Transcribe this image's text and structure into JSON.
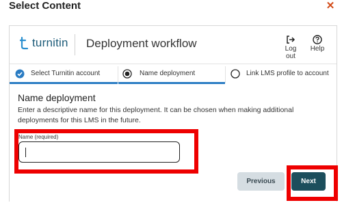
{
  "modal": {
    "title": "Select Content",
    "close_icon": "close-icon",
    "close_color": "#d24a17"
  },
  "app": {
    "logo_text": "turnitin",
    "logo_color": "#1b5a78",
    "title": "Deployment workflow",
    "logout_label": "Log out",
    "help_label": "Help"
  },
  "stepper": {
    "accent_color": "#2a7cc3",
    "steps": [
      {
        "label": "Select Turnitin account",
        "state": "completed",
        "icon": "check-circle-icon"
      },
      {
        "label": "Name deployment",
        "state": "current",
        "icon": "radio-selected-icon"
      },
      {
        "label": "Link LMS profile to account",
        "state": "pending",
        "icon": "radio-empty-icon"
      }
    ]
  },
  "form": {
    "section_title": "Name deployment",
    "description": "Enter a descriptive name for this deployment. It can be chosen when making additional deployments for this LMS in the future.",
    "name_label": "Name (required)",
    "name_value": ""
  },
  "actions": {
    "previous_label": "Previous",
    "next_label": "Next",
    "previous_bg": "#d5dde2",
    "next_bg": "#1c4e5c"
  },
  "annotations": {
    "highlight_color": "#ee0000"
  }
}
